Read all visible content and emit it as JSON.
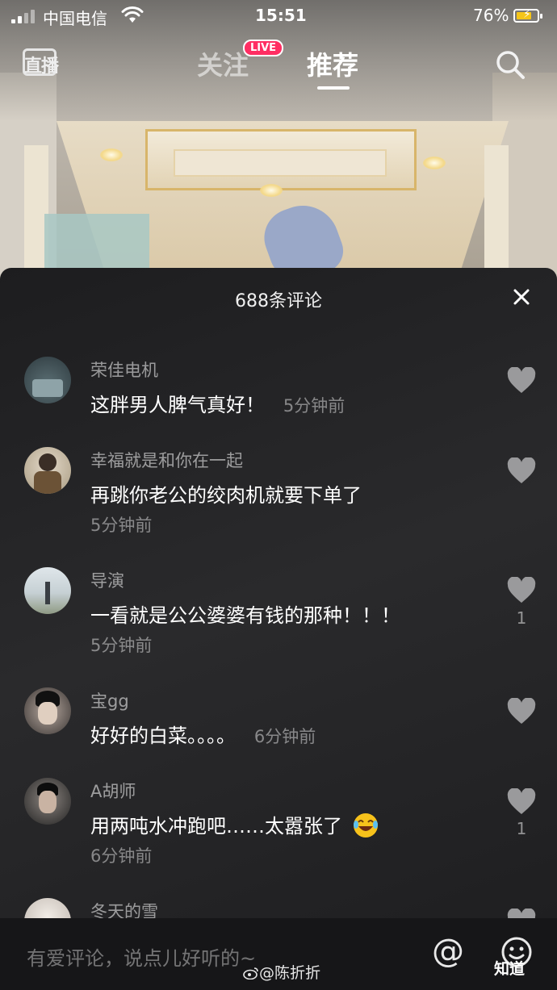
{
  "status_bar": {
    "carrier": "中国电信",
    "time": "15:51",
    "battery": "76%",
    "battery_level": 0.76
  },
  "nav": {
    "live_label": "直播",
    "tab_follow": "关注",
    "live_badge": "LIVE",
    "tab_recommend": "推荐",
    "active_tab": "推荐"
  },
  "comments_panel": {
    "title": "688条评论",
    "comments": [
      {
        "user": "荣佳电机",
        "text": "这胖男人脾气真好！",
        "time": "5分钟前",
        "likes": ""
      },
      {
        "user": "幸福就是和你在一起",
        "text": "再跳你老公的绞肉机就要下单了",
        "time": "5分钟前",
        "likes": ""
      },
      {
        "user": "导演",
        "text": "一看就是公公婆婆有钱的那种！！！",
        "time": "5分钟前",
        "likes": "1"
      },
      {
        "user": "宝gg",
        "text": "好好的白菜。。。。",
        "time": "6分钟前",
        "likes": ""
      },
      {
        "user": "A胡师",
        "text": "用两吨水冲跑吧……太嚣张了",
        "time": "6分钟前",
        "likes": "1"
      },
      {
        "user": "冬天的雪",
        "text": "",
        "time": "",
        "likes": ""
      }
    ]
  },
  "bottom_bar": {
    "input_placeholder": "有爱评论，说点儿好听的~",
    "watermark": "@陈折折",
    "zhihu": "知道"
  },
  "colors": {
    "live_badge": "#ff2e63",
    "battery": "#f5c518",
    "panel_bg": "#1f1f21"
  }
}
